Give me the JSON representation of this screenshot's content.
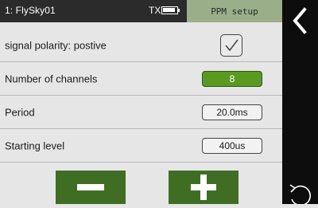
{
  "header": {
    "model_name": "1: FlySky01",
    "tx_label": "TX",
    "page_title": "PPM setup"
  },
  "rows": [
    {
      "label": "signal polarity: postive",
      "type": "checkbox",
      "checked": true
    },
    {
      "label": "Number of channels",
      "type": "value",
      "value": "8",
      "active": true
    },
    {
      "label": "Period",
      "type": "value",
      "value": "20.0ms",
      "active": false
    },
    {
      "label": "Starting level",
      "type": "value",
      "value": "400us",
      "active": false
    }
  ],
  "controls": {
    "minus_icon": "minus-icon",
    "plus_icon": "plus-icon",
    "back_icon": "chevron-left-icon",
    "undo_icon": "undo-icon"
  },
  "colors": {
    "topbar": "#2b2b2b",
    "page_title_bg": "#9aae8a",
    "active_value_bg": "#5a9a20",
    "button_green": "#3f6e22",
    "sidebar": "#0d0d0d",
    "background": "#e6e6e6"
  }
}
